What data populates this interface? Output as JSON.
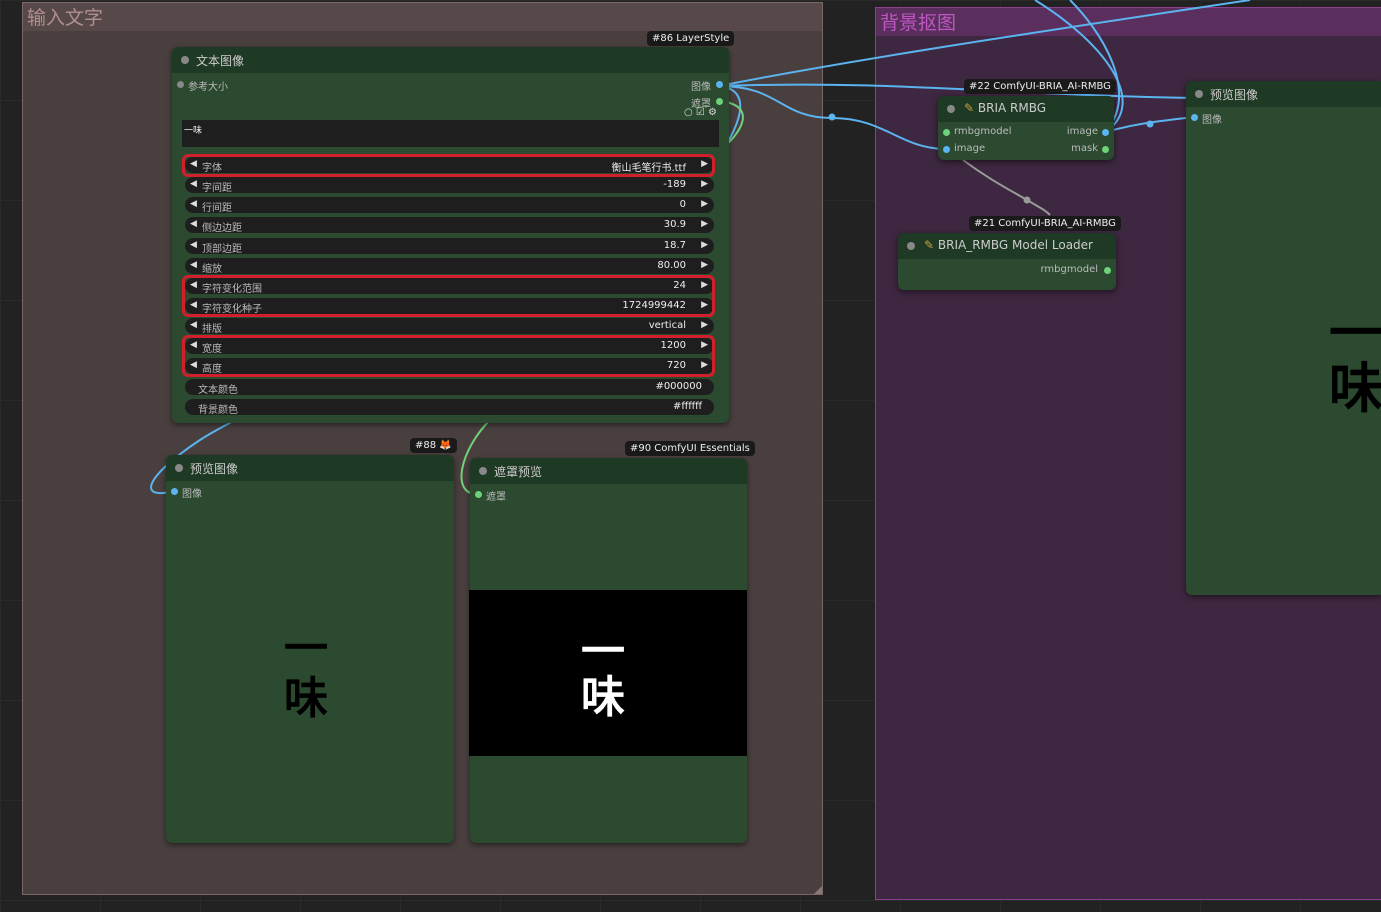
{
  "groups": {
    "input_text": {
      "title": "输入文字"
    },
    "bg_removal": {
      "title": "背景抠图"
    }
  },
  "text_image_node": {
    "badge": "#86 LayerStyle",
    "title": "文本图像",
    "input_ref_size": "参考大小",
    "output_image": "图像",
    "output_mask": "遮罩",
    "text_value": "一味",
    "widgets": [
      {
        "label": "字体",
        "value": "衡山毛笔行书.ttf"
      },
      {
        "label": "字间距",
        "value": "-189"
      },
      {
        "label": "行间距",
        "value": "0"
      },
      {
        "label": "侧边边距",
        "value": "30.9"
      },
      {
        "label": "顶部边距",
        "value": "18.7"
      },
      {
        "label": "缩放",
        "value": "80.00"
      },
      {
        "label": "字符变化范围",
        "value": "24"
      },
      {
        "label": "字符变化种子",
        "value": "1724999442"
      },
      {
        "label": "排版",
        "value": "vertical"
      },
      {
        "label": "宽度",
        "value": "1200"
      },
      {
        "label": "高度",
        "value": "720"
      },
      {
        "label": "文本颜色",
        "value": "#000000"
      },
      {
        "label": "背景颜色",
        "value": "#ffffff"
      }
    ]
  },
  "preview_node_left": {
    "badge": "#88 🦊",
    "title": "预览图像",
    "input_image": "图像",
    "glyph_top": "一",
    "glyph_bottom": "味"
  },
  "mask_preview_node": {
    "badge": "#90 ComfyUI Essentials",
    "title": "遮罩预览",
    "input_mask": "遮罩",
    "glyph_top": "一",
    "glyph_bottom": "味"
  },
  "bria_rmbg_node": {
    "badge": "#22 ComfyUI-BRIA_AI-RMBG",
    "title": "BRIA RMBG",
    "input_model": "rmbgmodel",
    "input_image": "image",
    "output_image": "image",
    "output_mask": "mask"
  },
  "bria_loader_node": {
    "badge": "#21 ComfyUI-BRIA_AI-RMBG",
    "title": "BRIA_RMBG Model Loader",
    "output_model": "rmbgmodel"
  },
  "preview_node_right": {
    "title": "预览图像",
    "input_image": "图像",
    "glyph_top": "一",
    "glyph_bottom": "味"
  },
  "colors": {
    "node_body": "#2b4a30",
    "node_header": "#1f3a24",
    "image_link": "#5bb4f0",
    "mask_link": "#6ed27a",
    "highlight": "#d21f2c"
  }
}
